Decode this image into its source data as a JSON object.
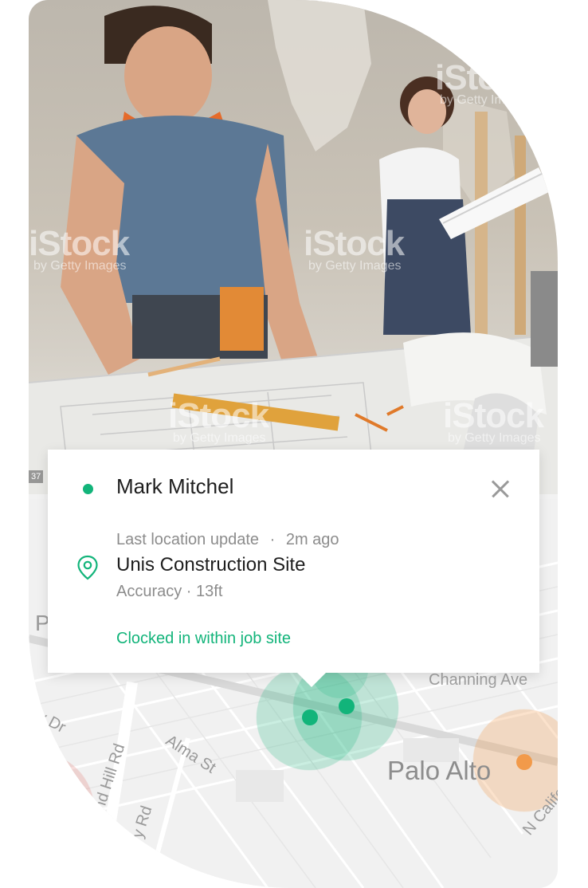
{
  "photo": {
    "watermark_brand": "iStock",
    "watermark_sub": "by Getty Images",
    "photo_id": "37"
  },
  "popup": {
    "name": "Mark Mitchel",
    "last_update_label": "Last location update",
    "separator": "·",
    "last_update_time": "2m ago",
    "site": "Unis Construction Site",
    "accuracy": "Accuracy · 13ft",
    "clock_status": "Clocked in within job site",
    "status_color": "#12b47a"
  },
  "map": {
    "labels": {
      "city": "Palo Alto",
      "channing": "Channing Ave",
      "alma": "Alma St",
      "sand_hill": "Sand Hill Rd",
      "quarry": "Quarry Rd",
      "university": "sity Dr",
      "california": "N Califo",
      "edge_p": "P"
    },
    "markers": [
      {
        "type": "worker",
        "color": "#12b47a"
      },
      {
        "type": "worker",
        "color": "#12b47a"
      },
      {
        "type": "site",
        "color": "#f29a4a"
      },
      {
        "type": "site",
        "color": "#e58a86"
      }
    ]
  }
}
